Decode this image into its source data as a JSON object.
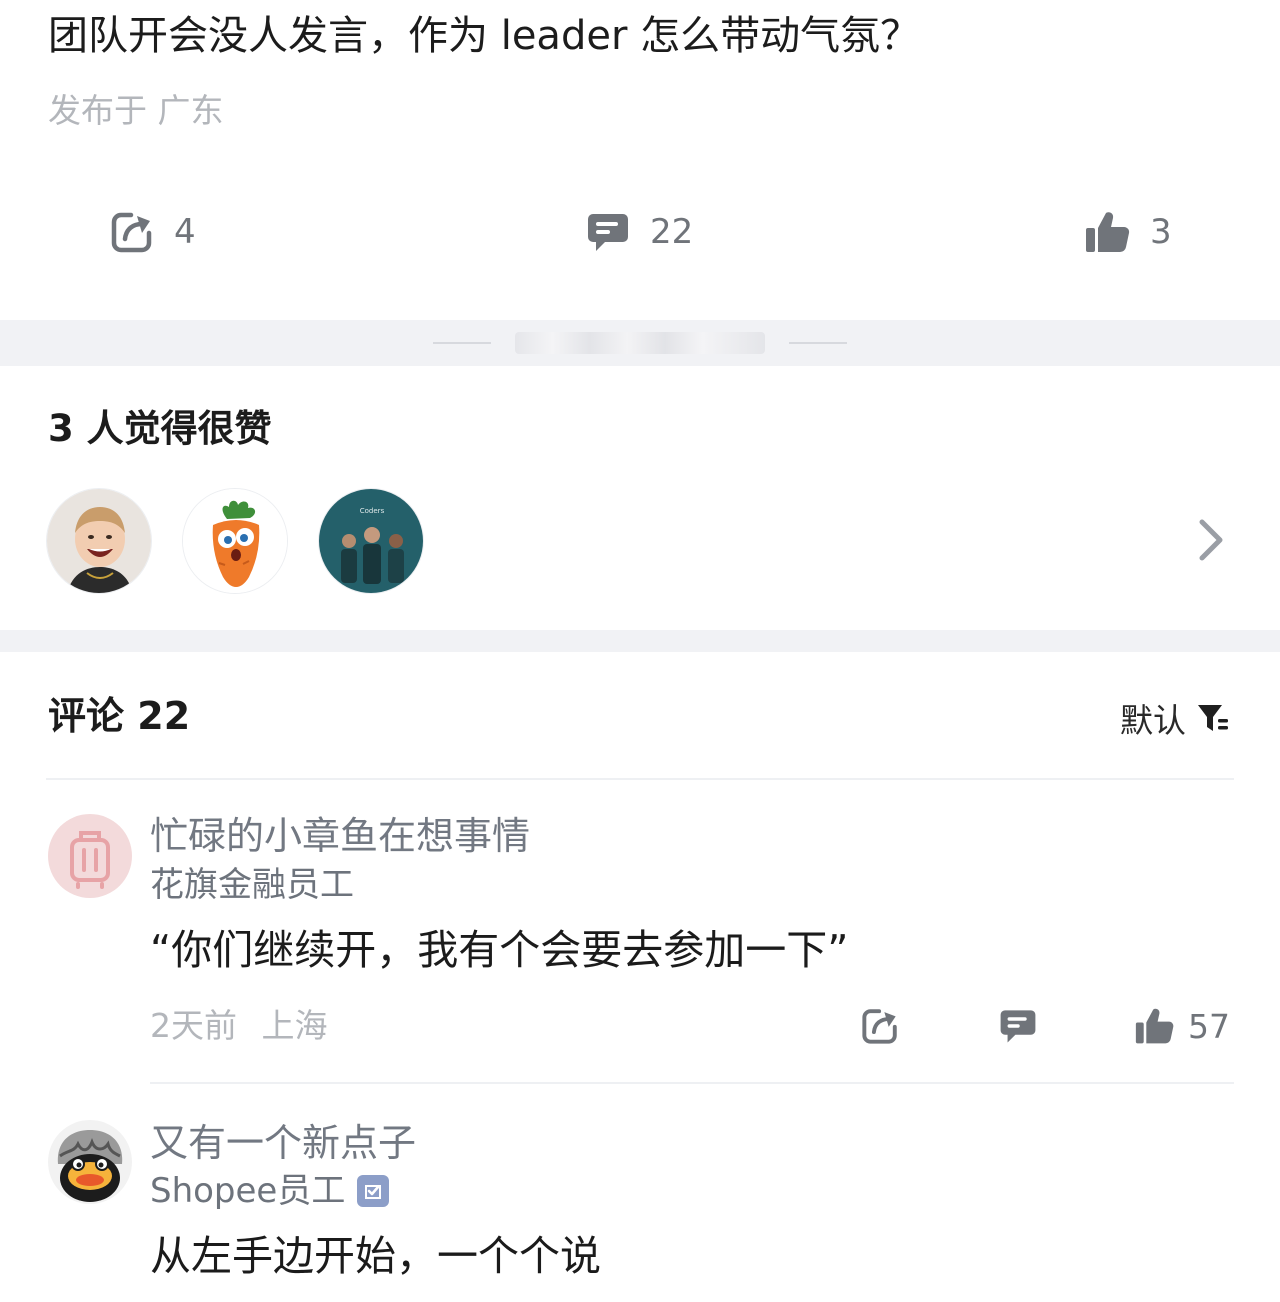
{
  "post": {
    "title": "团队开会没人发言，作为 leader 怎么带动气氛？",
    "location_prefix": "发布于",
    "location": "广东",
    "share_count": "4",
    "comment_count": "22",
    "like_count": "3"
  },
  "likes": {
    "title": "3 人觉得很赞",
    "avatars": [
      "smiling-kid-avatar",
      "cartoon-carrot-avatar",
      "group-photo-avatar"
    ],
    "group_caption": "Coders"
  },
  "comments": {
    "title": "评论",
    "count": "22",
    "sort_label": "默认",
    "items": [
      {
        "name": "忙碌的小章鱼在想事情",
        "company": "花旗金融员工",
        "body": "“你们继续开，我有个会要去参加一下”",
        "time": "2天前",
        "location": "上海",
        "like_count": "57"
      },
      {
        "name": "又有一个新点子",
        "company": "Shopee员工",
        "verified": true,
        "body": "从左手边开始，一个个说"
      }
    ]
  },
  "colors": {
    "accent_gray": "#70747a",
    "band": "#f1f2f5",
    "verified_badge": "#8c9ec8"
  }
}
